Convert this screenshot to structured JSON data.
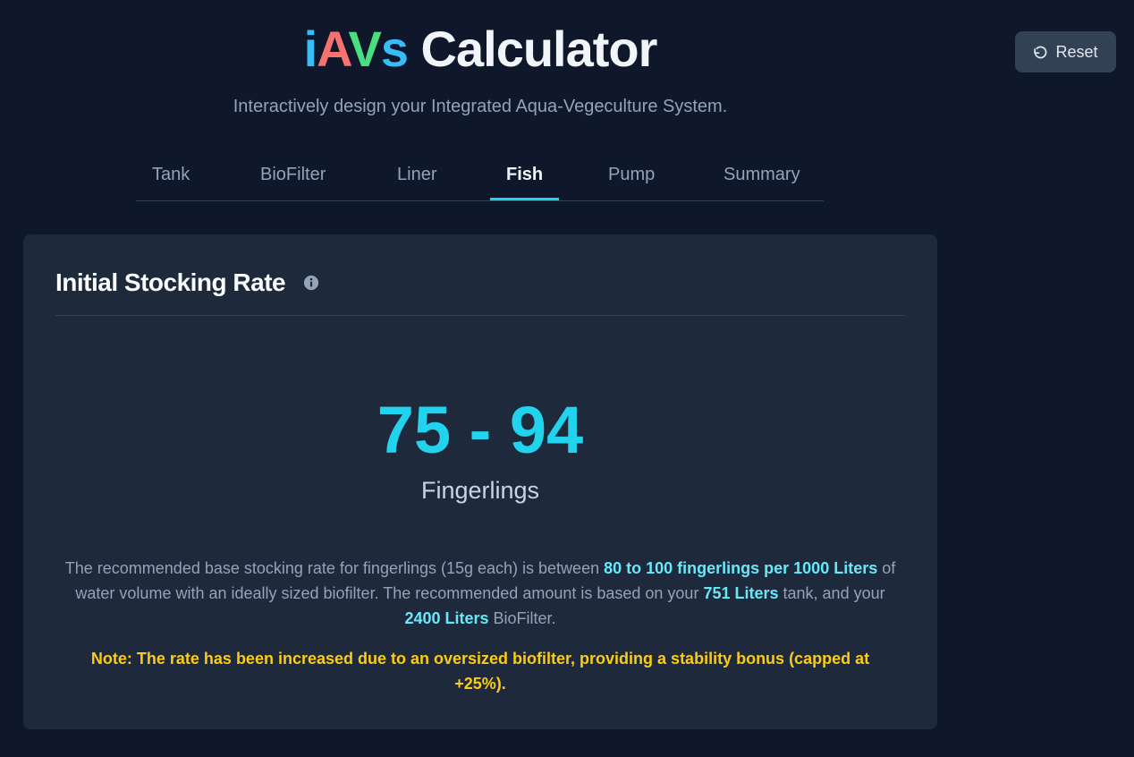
{
  "header": {
    "title_letters": [
      {
        "char": "i",
        "color": "#38bdf8"
      },
      {
        "char": "A",
        "color": "#f87171"
      },
      {
        "char": "V",
        "color": "#4ade80"
      },
      {
        "char": "s",
        "color": "#38bdf8"
      }
    ],
    "title_rest": " Calculator",
    "subtitle": "Interactively design your Integrated Aqua-Vegeculture System.",
    "reset_label": "Reset",
    "reset_icon": "undo-icon"
  },
  "tabs": [
    {
      "label": "Tank",
      "active": false
    },
    {
      "label": "BioFilter",
      "active": false
    },
    {
      "label": "Liner",
      "active": false
    },
    {
      "label": "Fish",
      "active": true
    },
    {
      "label": "Pump",
      "active": false
    },
    {
      "label": "Summary",
      "active": false
    }
  ],
  "card": {
    "title": "Initial Stocking Rate",
    "info_icon": "info-icon",
    "result_value": "75 - 94",
    "result_unit": "Fingerlings",
    "description": {
      "p1": "The recommended base stocking rate for fingerlings (15g each) is between ",
      "h1": "80 to 100 fingerlings per 1000 Liters",
      "p2": " of water volume with an ideally sized biofilter. The recommended amount is based on your ",
      "h2": "751 Liters",
      "p3": " tank, and your ",
      "h3": "2400 Liters",
      "p4": " BioFilter."
    },
    "note": "Note: The rate has been increased due to an oversized biofilter, providing a stability bonus (capped at +25%)."
  },
  "colors": {
    "background": "#0f172a",
    "card": "#1e293b",
    "accent": "#22d3ee",
    "highlight": "#67e8f9",
    "note": "#facc15"
  }
}
